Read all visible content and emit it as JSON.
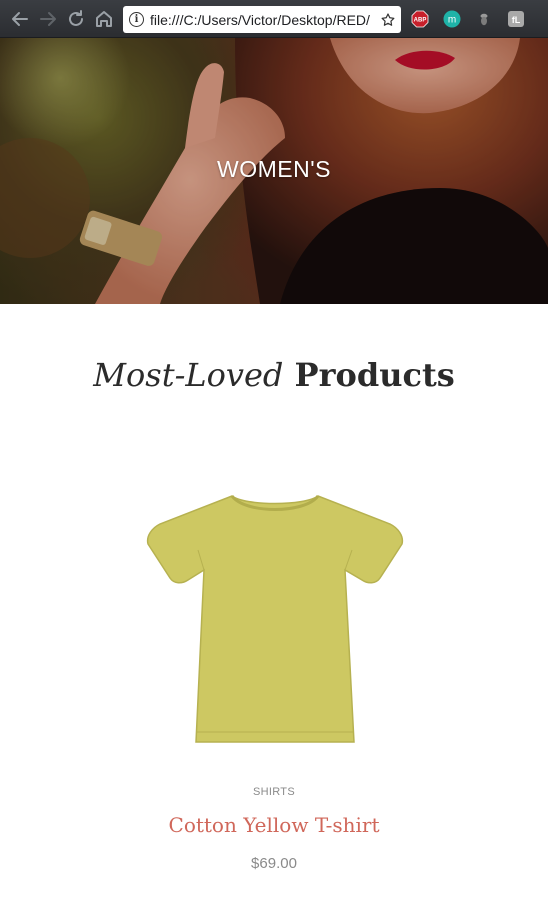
{
  "browser": {
    "url": "file:///C:/Users/Victor/Desktop/RED/",
    "extensions": [
      {
        "name": "adblock-plus-icon",
        "label": "ABP"
      },
      {
        "name": "m-extension-icon",
        "label": "m"
      },
      {
        "name": "acorn-extension-icon",
        "label": ""
      },
      {
        "name": "fl-extension-icon",
        "label": "fL"
      }
    ]
  },
  "hero": {
    "title": "WOMEN'S"
  },
  "section": {
    "title_italic": "Most-Loved",
    "title_bold": "Products"
  },
  "product": {
    "category": "SHIRTS",
    "name": "Cotton Yellow T-shirt",
    "price": "$69.00",
    "color": "#cdc862"
  },
  "colors": {
    "accent": "#d0675a",
    "heading": "#2b2b2b",
    "muted": "#8a8a8a"
  }
}
